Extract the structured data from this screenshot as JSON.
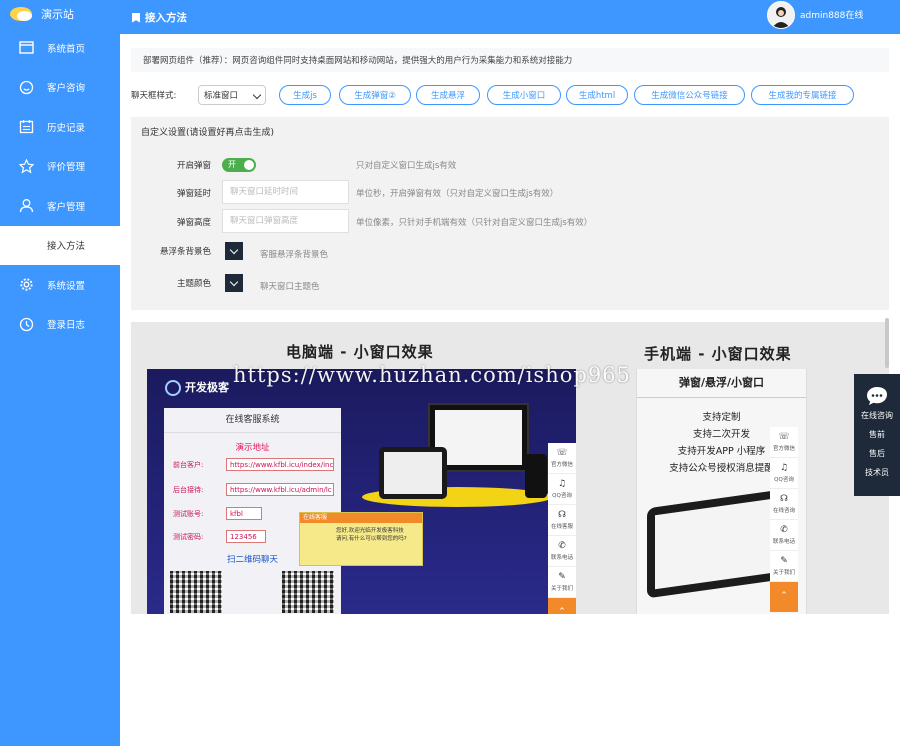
{
  "app": {
    "logo_text": "演示站"
  },
  "sidebar": {
    "items": [
      {
        "label": "系统首页",
        "icon": "window-icon"
      },
      {
        "label": "客户咨询",
        "icon": "smiley-icon"
      },
      {
        "label": "历史记录",
        "icon": "calendar-icon"
      },
      {
        "label": "评价管理",
        "icon": "star-icon"
      },
      {
        "label": "客户管理",
        "icon": "user-icon"
      },
      {
        "label": "接入方法",
        "icon": "",
        "active": true
      },
      {
        "label": "系统设置",
        "icon": "gear-icon"
      },
      {
        "label": "登录日志",
        "icon": "clock-icon"
      }
    ]
  },
  "header": {
    "title": "接入方法",
    "user": "admin888在线"
  },
  "description": "部署网页组件（推荐）：网页咨询组件同时支持桌面网站和移动网站，提供强大的用户行为采集能力和系统对接能力",
  "style_selector": {
    "label": "聊天框样式:",
    "value": "标准窗口"
  },
  "generate_buttons": [
    "生成js",
    "生成弹窗②",
    "生成悬浮",
    "生成小窗口",
    "生成html",
    "生成微信公众号链接",
    "生成我的专属链接"
  ],
  "custom": {
    "title": "自定义设置(请设置好再点击生成)",
    "popup_label": "开启弹窗",
    "popup_toggle": "开",
    "popup_hint": "只对自定义窗口生成js有效",
    "delay_label": "弹窗延时",
    "delay_placeholder": "聊天窗口延时时间",
    "delay_hint": "单位秒，开启弹窗有效（只对自定义窗口生成js有效）",
    "height_label": "弹窗高度",
    "height_placeholder": "聊天窗口弹窗高度",
    "height_hint": "单位像素，只针对手机端有效（只针对自定义窗口生成js有效）",
    "float_bg_label": "悬浮条背景色",
    "float_bg_hint": "客服悬浮条背景色",
    "theme_label": "主题颜色",
    "theme_hint": "聊天窗口主题色",
    "color": "#1e2a3a"
  },
  "preview": {
    "pc_title": "电脑端 - 小窗口效果",
    "mobile_title": "手机端 - 小窗口效果",
    "pc_logo": "开发极客",
    "service_title": "在线客服系统",
    "demo_address": "演示地址",
    "front_label": "前台客户:",
    "front_url": "https://www.kfbl.icu/index/inc",
    "back_label": "后台接待:",
    "back_url": "https://www.kfbl.icu/admin/lc",
    "account_label": "测试账号:",
    "account": "kfbl",
    "password_label": "测试密码:",
    "password": "123456",
    "qr_title": "扫二维码聊天",
    "popup_title": "在线客服",
    "popup_text_1": "您好,欢迎光临开发极客科技",
    "popup_text_2": "请问,有什么可以帮到您的吗?",
    "mobile_header": "弹窗/悬浮/小窗口",
    "mobile_lines": [
      "支持定制",
      "支持二次开发",
      "支持开发APP 小程序",
      "支持公众号授权消息提醒"
    ],
    "pc_tools": [
      "官方微信",
      "QQ咨询",
      "在线客服",
      "联系电话",
      "关于我们"
    ],
    "mobile_tools": [
      "官方微信",
      "QQ咨询",
      "在线咨询",
      "联系电话",
      "关于我们"
    ]
  },
  "watermark": "https://www.huzhan.com/ishop965",
  "floating": {
    "title": "在线咨询",
    "items": [
      "售前",
      "售后",
      "技术员"
    ]
  }
}
